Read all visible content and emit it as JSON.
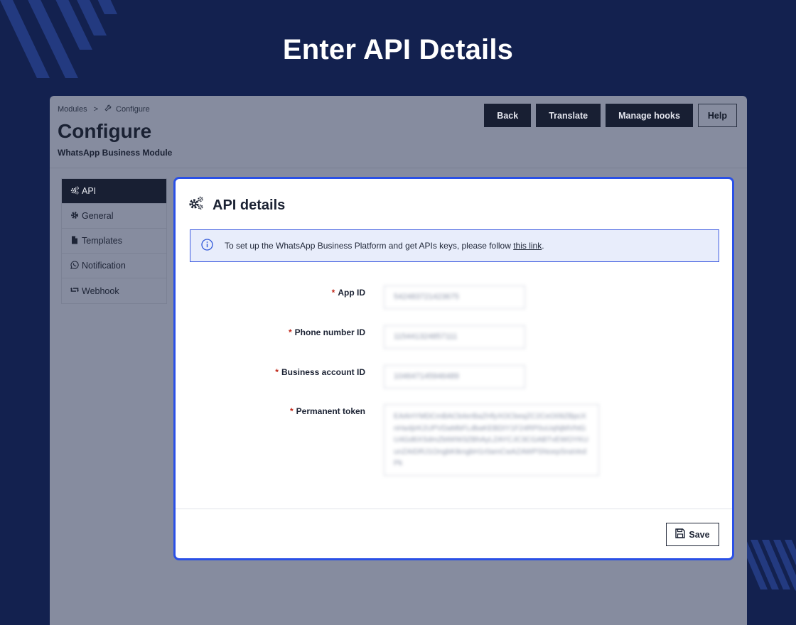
{
  "hero": {
    "title": "Enter API Details"
  },
  "breadcrumb": {
    "modules": "Modules",
    "separator": ">",
    "current": "Configure"
  },
  "header": {
    "title": "Configure",
    "subtitle": "WhatsApp Business Module"
  },
  "toolbar": {
    "back": "Back",
    "translate": "Translate",
    "manage_hooks": "Manage hooks",
    "help": "Help"
  },
  "sidebar": {
    "items": [
      {
        "label": "API",
        "icon": "gears-icon",
        "active": true
      },
      {
        "label": "General",
        "icon": "gear-icon",
        "active": false
      },
      {
        "label": "Templates",
        "icon": "file-icon",
        "active": false
      },
      {
        "label": "Notification",
        "icon": "whatsapp-icon",
        "active": false
      },
      {
        "label": "Webhook",
        "icon": "retweet-icon",
        "active": false
      }
    ]
  },
  "panel": {
    "title": "API details",
    "info": {
      "text": "To set up the WhatsApp Business Platform and get APIs keys, please follow ",
      "link": "this link",
      "suffix": "."
    },
    "fields": [
      {
        "label": "App ID",
        "value": "542483721423675"
      },
      {
        "label": "Phone number ID",
        "value": "115441324857111"
      },
      {
        "label": "Business account ID",
        "value": "104647145946489"
      },
      {
        "label": "Permanent token",
        "value": "EAAHYMDCmBACb4erBaZHfyXOCbeqZC2CeO09ZBpcXnHa4jirK2UPVDaMbFLdbaKEBDIY1F24RP0uUqNjMVhtGU4Gd6XSdmZbtWW3ZBhAyLZAYCJC3CGABTvEWOYKUunZAIDRJ1OngbKtkngbH1r0amCwAZAWPSNoepSnaVedPk"
      }
    ],
    "required_mark": "*",
    "save": "Save"
  },
  "colors": {
    "background": "#13214f",
    "accent": "#2a50e6",
    "dark": "#181f33",
    "required": "#c0281a"
  }
}
